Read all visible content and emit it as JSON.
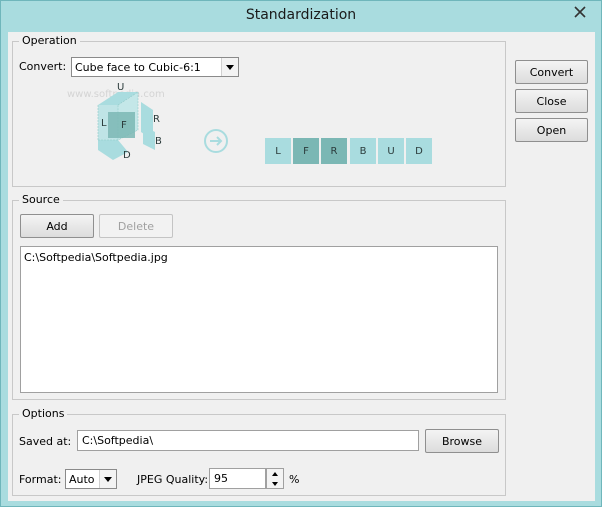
{
  "window": {
    "title": "Standardization"
  },
  "side_buttons": {
    "convert": "Convert",
    "close": "Close",
    "open": "Open"
  },
  "operation": {
    "legend": "Operation",
    "convert_label": "Convert:",
    "convert_value": "Cube face to Cubic-6:1",
    "watermark": "www.softpedia.com",
    "cube_labels": {
      "u": "U",
      "l": "L",
      "f": "F",
      "r": "R",
      "b": "B",
      "d": "D"
    },
    "strip": [
      {
        "label": "L",
        "shade": "light"
      },
      {
        "label": "F",
        "shade": "dark"
      },
      {
        "label": "R",
        "shade": "dark"
      },
      {
        "label": "B",
        "shade": "light"
      },
      {
        "label": "U",
        "shade": "light"
      },
      {
        "label": "D",
        "shade": "light"
      }
    ]
  },
  "source": {
    "legend": "Source",
    "add": "Add",
    "delete": "Delete",
    "files": [
      "C:\\Softpedia\\Softpedia.jpg"
    ]
  },
  "options": {
    "legend": "Options",
    "saved_at_label": "Saved at:",
    "saved_at_value": "C:\\Softpedia\\",
    "browse": "Browse",
    "format_label": "Format:",
    "format_value": "Auto",
    "quality_label": "JPEG Quality:",
    "quality_value": "95",
    "percent": "%"
  },
  "colors": {
    "accent": "#a9dcdf",
    "tile_dark": "#7bb7b4",
    "arrow": "#a9dcdf"
  }
}
